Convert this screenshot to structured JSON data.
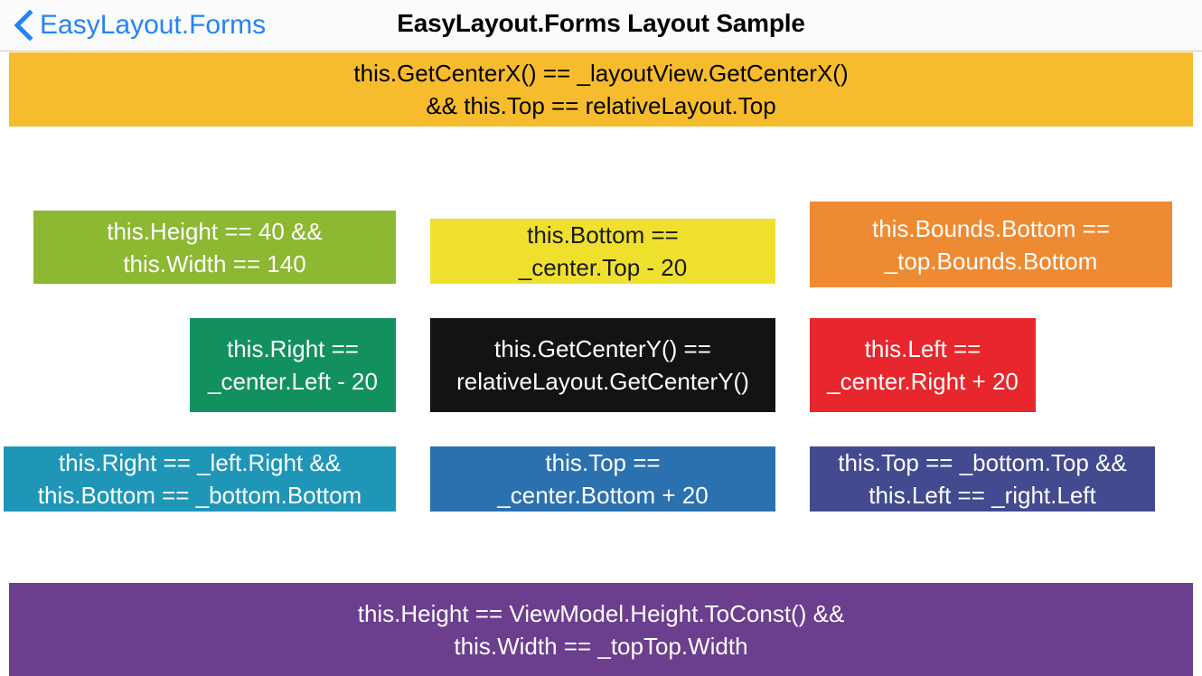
{
  "nav": {
    "back_label": "EasyLayout.Forms",
    "back_icon": "chevron-left-icon",
    "title": "EasyLayout.Forms Layout Sample",
    "accent_color": "#2483f5"
  },
  "boxes": {
    "top_banner": {
      "text": "this.GetCenterX() == _layoutView.GetCenterX()\n&& this.Top == relativeLayout.Top",
      "background": "#f7bc2e",
      "text_color": "#000000"
    },
    "top_left": {
      "text": "this.Height == 40 &&\nthis.Width == 140",
      "background": "#8cb832",
      "text_color": "#ffffff"
    },
    "top_center": {
      "text": "this.Bottom ==\n_center.Top - 20",
      "background": "#efe02e",
      "text_color": "#1a1a1a"
    },
    "top_right": {
      "text": "this.Bounds.Bottom ==\n_top.Bounds.Bottom",
      "background": "#ee8b32",
      "text_color": "#ffffff"
    },
    "mid_left": {
      "text": "this.Right ==\n_center.Left - 20",
      "background": "#12915e",
      "text_color": "#ffffff"
    },
    "mid_center": {
      "text": "this.GetCenterY() ==\nrelativeLayout.GetCenterY()",
      "background": "#131313",
      "text_color": "#ffffff"
    },
    "mid_right": {
      "text": "this.Left ==\n_center.Right + 20",
      "background": "#e8262d",
      "text_color": "#ffffff"
    },
    "bottom_left": {
      "text": "this.Right == _left.Right &&\nthis.Bottom == _bottom.Bottom",
      "background": "#1f96b8",
      "text_color": "#ffffff"
    },
    "bottom_center": {
      "text": "this.Top ==\n_center.Bottom + 20",
      "background": "#2b71b0",
      "text_color": "#ffffff"
    },
    "bottom_right": {
      "text": "this.Top == _bottom.Top &&\nthis.Left == _right.Left",
      "background": "#434a8f",
      "text_color": "#ffffff"
    },
    "bottom_banner": {
      "text": "this.Height == ViewModel.Height.ToConst() &&\nthis.Width == _topTop.Width",
      "background": "#6b3e8e",
      "text_color": "#ffffff"
    }
  }
}
